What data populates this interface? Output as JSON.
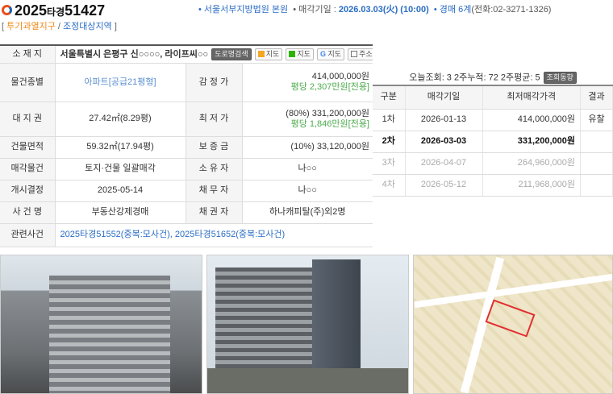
{
  "header": {
    "case_year": "2025",
    "case_type": "타경",
    "case_no": "51427",
    "court": "• 서울서부지방법원 본원",
    "sale_date_label": "• 매각기일 : ",
    "sale_date": "2026.03.03(火) (10:00)",
    "dept": "• 경매 6계",
    "phone": "(전화:02-3271-1326)",
    "zone1": "투기과열지구",
    "zone2": "조정대상지역"
  },
  "address": {
    "label": "소 재 지",
    "value": "서울특별시 은평구 신○○○○, 라이프씨○○",
    "buttons": [
      "도로명검색",
      "지도",
      "지도",
      "지도",
      "주소 복사"
    ]
  },
  "rows": [
    {
      "l1": "물건종별",
      "v1": "아파트[공급21평형]",
      "l2": "감 정 가",
      "v2": "414,000,000원",
      "v2b": "평당 2,307만원[전용]"
    },
    {
      "l1": "대 지 권",
      "v1": "27.42㎡(8.29평)",
      "l2": "최 저 가",
      "v2": "(80%) 331,200,000원",
      "v2b": "평당 1,846만원[전용]"
    },
    {
      "l1": "건물면적",
      "v1": "59.32㎡(17.94평)",
      "l2": "보 증 금",
      "v2": "(10%) 33,120,000원"
    },
    {
      "l1": "매각물건",
      "v1": "토지·건물 일괄매각",
      "l2": "소 유 자",
      "v2": "나○○"
    },
    {
      "l1": "개시결정",
      "v1": "2025-05-14",
      "l2": "채 무 자",
      "v2": "나○○"
    },
    {
      "l1": "사 건 명",
      "v1": "부동산강제경매",
      "l2": "채 권 자",
      "v2": "하나캐피탈(주)외2명"
    }
  ],
  "related": {
    "label": "관련사건",
    "links": [
      "2025타경51552(중복:모사건)",
      "2025타경51652(중복:모사건)"
    ]
  },
  "views": {
    "text": "오늘조회: 3  2주누적: 72  2주평균: 5",
    "button": "조회동향"
  },
  "schedule": {
    "headers": [
      "구분",
      "매각기일",
      "최저매각가격",
      "결과"
    ],
    "rows": [
      [
        "1차",
        "2026-01-13",
        "414,000,000원",
        "유찰"
      ],
      [
        "2차",
        "2026-03-03",
        "331,200,000원",
        ""
      ],
      [
        "3차",
        "2026-04-07",
        "264,960,000원",
        ""
      ],
      [
        "4차",
        "2026-05-12",
        "211,968,000원",
        ""
      ]
    ]
  },
  "colors": {
    "accent": "#2a6cc4",
    "orange": "#f08a1a",
    "green": "#4caa4c"
  }
}
